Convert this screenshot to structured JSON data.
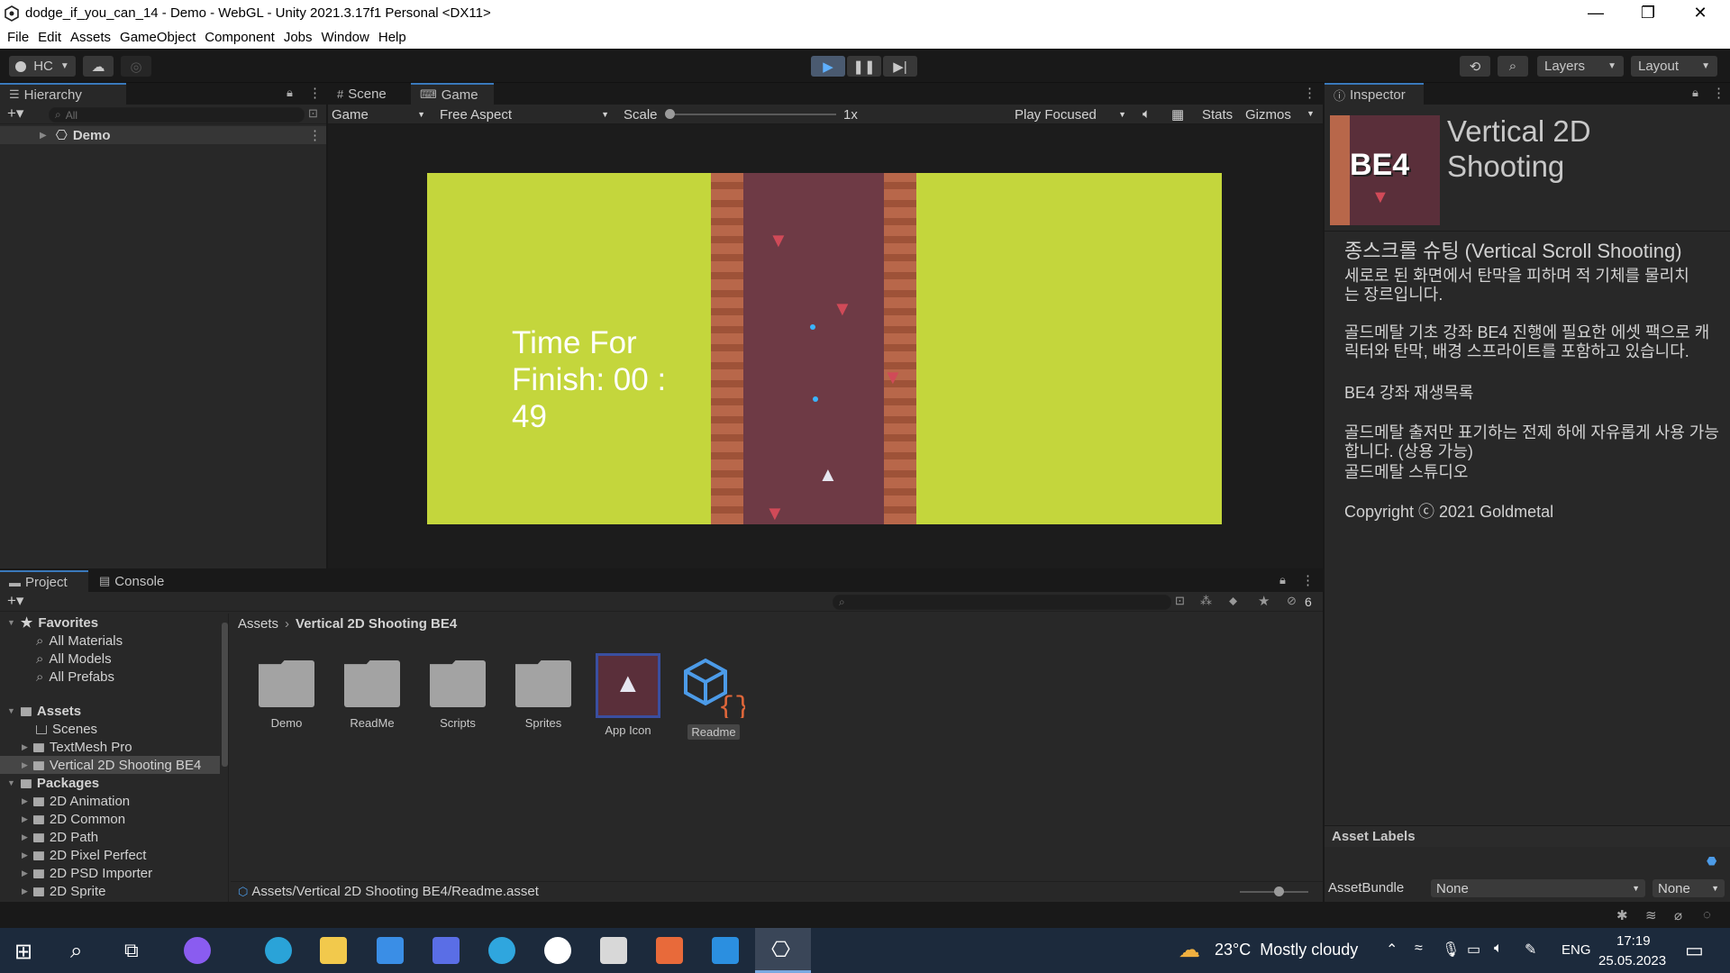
{
  "window": {
    "title": "dodge_if_you_can_14 - Demo - WebGL - Unity 2021.3.17f1 Personal <DX11>",
    "controls": [
      "—",
      "❐",
      "✕"
    ]
  },
  "menu": [
    "File",
    "Edit",
    "Assets",
    "GameObject",
    "Component",
    "Jobs",
    "Window",
    "Help"
  ],
  "toolbar": {
    "account": "HC",
    "layers": "Layers",
    "layout": "Layout"
  },
  "hierarchy": {
    "tab": "Hierarchy",
    "search_placeholder": "All",
    "root": "Demo"
  },
  "game_view": {
    "tabs": [
      "Scene",
      "Game"
    ],
    "display": "Game",
    "aspect": "Free Aspect",
    "scale_label": "Scale",
    "scale_value": "1x",
    "play_mode": "Play Focused",
    "stats": "Stats",
    "gizmos": "Gizmos",
    "hud_text": "Time For Finish: 00 : 49",
    "colors": {
      "grass": "#c4d63c",
      "road": "#6e3a45",
      "border": "#b8674a"
    }
  },
  "inspector": {
    "tab": "Inspector",
    "icon_text": "BE4",
    "title": "Vertical 2D Shooting",
    "heading": "종스크롤 슈팅 (Vertical Scroll Shooting)",
    "p1": "세로로 된 화면에서 탄막을 피하며 적 기체를 물리치는 장르입니다.",
    "p2": "골드메탈 기초 강좌 BE4 진행에 필요한 에셋 팩으로 캐릭터와 탄막, 배경 스프라이트를 포함하고 있습니다.",
    "link1": "BE4 강좌 재생목록",
    "p3": "골드메탈 출저만 표기하는 전제 하에 자유롭게 사용 가능합니다. (상용 가능)",
    "link2": "골드메탈 스튜디오",
    "copyright": "Copyright ⓒ 2021 Goldmetal",
    "asset_labels": "Asset Labels",
    "asset_bundle_label": "AssetBundle",
    "asset_bundle_value": "None",
    "variant_value": "None"
  },
  "project": {
    "tabs": [
      "Project",
      "Console"
    ],
    "hidden_count": "6",
    "favorites_label": "Favorites",
    "favorites": [
      "All Materials",
      "All Models",
      "All Prefabs"
    ],
    "assets_label": "Assets",
    "assets": [
      "Scenes",
      "TextMesh Pro",
      "Vertical 2D Shooting BE4"
    ],
    "packages_label": "Packages",
    "packages": [
      "2D Animation",
      "2D Common",
      "2D Path",
      "2D Pixel Perfect",
      "2D PSD Importer",
      "2D Sprite"
    ],
    "breadcrumb": [
      "Assets",
      "Vertical 2D Shooting BE4"
    ],
    "items": [
      "Demo",
      "ReadMe",
      "Scripts",
      "Sprites",
      "App Icon",
      "Readme"
    ],
    "status_path": "Assets/Vertical 2D Shooting BE4/Readme.asset"
  },
  "taskbar": {
    "weather": "23°C  Mostly cloudy",
    "lang": "ENG",
    "time": "17:19",
    "date": "25.05.2023"
  }
}
